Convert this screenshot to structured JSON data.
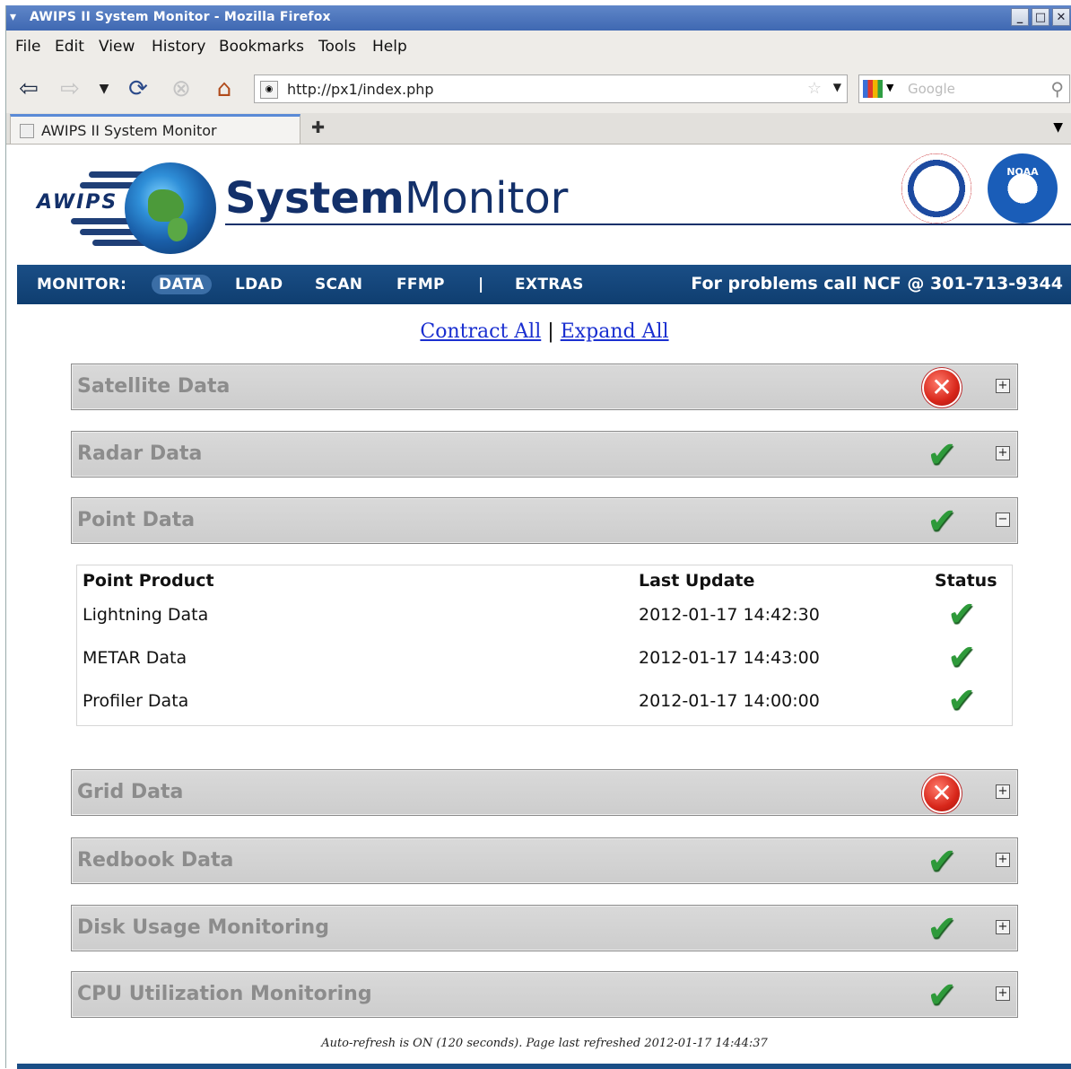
{
  "window": {
    "title": "AWIPS II System Monitor - Mozilla Firefox",
    "buttons": [
      "_",
      "□",
      "✕"
    ]
  },
  "menu": {
    "items": [
      "File",
      "Edit",
      "View",
      "History",
      "Bookmarks",
      "Tools",
      "Help"
    ]
  },
  "toolbar": {
    "url": "http://px1/index.php",
    "search_placeholder": "Google"
  },
  "tabs": [
    {
      "label": "AWIPS II System Monitor"
    }
  ],
  "header": {
    "logo_text": "AWIPS",
    "title_bold": "System",
    "title_regular": "Monitor",
    "noaa_label": "NOAA"
  },
  "nav": {
    "label": "MONITOR:",
    "items": [
      "DATA",
      "LDAD",
      "SCAN",
      "FFMP",
      "|",
      "EXTRAS"
    ],
    "active": "DATA",
    "phone": "For problems call NCF @ 301-713-9344"
  },
  "links": {
    "contract": "Contract All",
    "separator": "|",
    "expand": "Expand All"
  },
  "sections": [
    {
      "title": "Satellite Data",
      "status": "error",
      "expanded": false
    },
    {
      "title": "Radar Data",
      "status": "ok",
      "expanded": false
    },
    {
      "title": "Point Data",
      "status": "ok",
      "expanded": true
    },
    {
      "title": "Grid Data",
      "status": "error",
      "expanded": false
    },
    {
      "title": "Redbook Data",
      "status": "ok",
      "expanded": false
    },
    {
      "title": "Disk Usage Monitoring",
      "status": "ok",
      "expanded": false
    },
    {
      "title": "CPU Utilization Monitoring",
      "status": "ok",
      "expanded": false
    }
  ],
  "point_table": {
    "headers": [
      "Point Product",
      "Last Update",
      "Status"
    ],
    "rows": [
      {
        "product": "Lightning Data",
        "updated": "2012-01-17 14:42:30",
        "status": "ok"
      },
      {
        "product": "METAR Data",
        "updated": "2012-01-17 14:43:00",
        "status": "ok"
      },
      {
        "product": "Profiler Data",
        "updated": "2012-01-17 14:00:00",
        "status": "ok"
      }
    ]
  },
  "footer": {
    "note": "Auto-refresh is ON (120 seconds). Page last refreshed 2012-01-17 14:44:37"
  },
  "colors": {
    "nav_bg": "#1a4e86",
    "ok": "#2e9a3a",
    "error": "#d7261a",
    "link": "#1a2fd0"
  }
}
